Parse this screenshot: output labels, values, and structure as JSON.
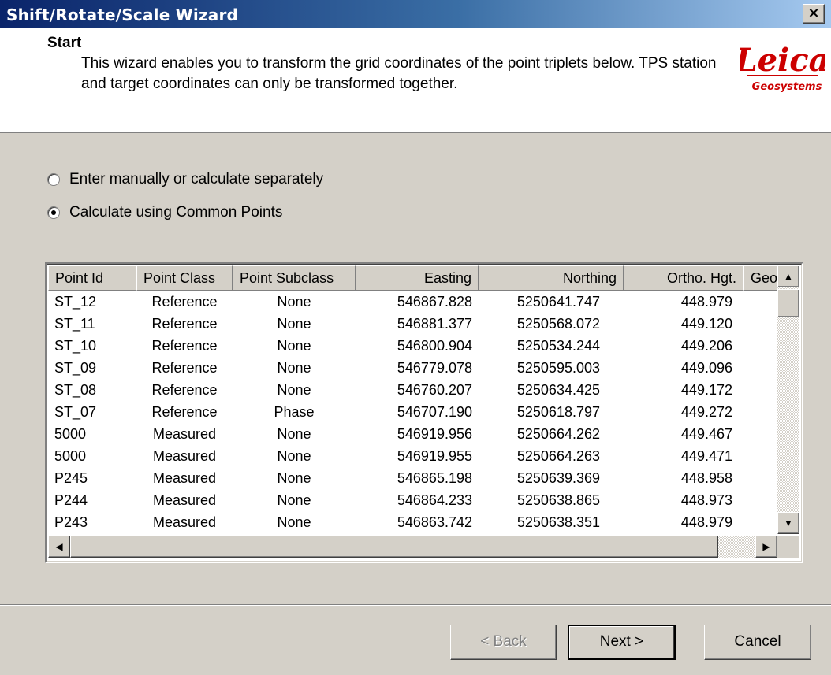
{
  "window": {
    "title": "Shift/Rotate/Scale Wizard",
    "close_label": "×"
  },
  "header": {
    "title": "Start",
    "description": "This wizard enables you to transform the grid coordinates of the point triplets below. TPS station and target coordinates can only be transformed together.",
    "logo_text": "Leica",
    "logo_subtext": "Geosystems",
    "logo_color": "#cc0000"
  },
  "options": [
    {
      "label": "Enter manually or calculate separately",
      "selected": false
    },
    {
      "label": "Calculate using Common Points",
      "selected": true
    }
  ],
  "table": {
    "columns": [
      "Point Id",
      "Point Class",
      "Point Subclass",
      "Easting",
      "Northing",
      "Ortho. Hgt.",
      "Geo"
    ],
    "rows": [
      [
        "ST_12",
        "Reference",
        "None",
        "546867.828",
        "5250641.747",
        "448.979"
      ],
      [
        "ST_11",
        "Reference",
        "None",
        "546881.377",
        "5250568.072",
        "449.120"
      ],
      [
        "ST_10",
        "Reference",
        "None",
        "546800.904",
        "5250534.244",
        "449.206"
      ],
      [
        "ST_09",
        "Reference",
        "None",
        "546779.078",
        "5250595.003",
        "449.096"
      ],
      [
        "ST_08",
        "Reference",
        "None",
        "546760.207",
        "5250634.425",
        "449.172"
      ],
      [
        "ST_07",
        "Reference",
        "Phase",
        "546707.190",
        "5250618.797",
        "449.272"
      ],
      [
        "5000",
        "Measured",
        "None",
        "546919.956",
        "5250664.262",
        "449.467"
      ],
      [
        "5000",
        "Measured",
        "None",
        "546919.955",
        "5250664.263",
        "449.471"
      ],
      [
        "P245",
        "Measured",
        "None",
        "546865.198",
        "5250639.369",
        "448.958"
      ],
      [
        "P244",
        "Measured",
        "None",
        "546864.233",
        "5250638.865",
        "448.973"
      ],
      [
        "P243",
        "Measured",
        "None",
        "546863.742",
        "5250638.351",
        "448.979"
      ]
    ]
  },
  "buttons": {
    "back": "< Back",
    "next": "Next >",
    "cancel": "Cancel"
  }
}
